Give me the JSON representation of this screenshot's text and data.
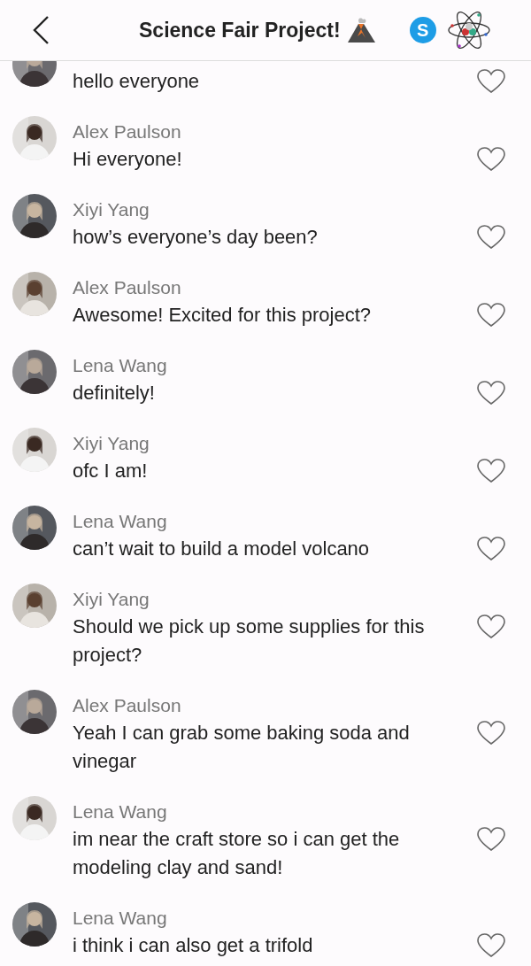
{
  "header": {
    "title": "Science Fair Project!",
    "group_badge": "S"
  },
  "messages": [
    {
      "text": "hello everyone",
      "liked": false
    },
    {
      "name": "Alex Paulson",
      "text": "Hi everyone!",
      "liked": false
    },
    {
      "name": "Xiyi Yang",
      "text": "how’s everyone’s day been?",
      "liked": false
    },
    {
      "name": "Alex Paulson",
      "text": "Awesome! Excited for this project?",
      "liked": false
    },
    {
      "name": "Lena Wang",
      "text": "definitely!",
      "liked": false
    },
    {
      "name": "Xiyi Yang",
      "text": "ofc I am!",
      "liked": false
    },
    {
      "name": "Lena Wang",
      "text": "can’t wait to build a model volcano",
      "liked": false
    },
    {
      "name": "Xiyi Yang",
      "text": "Should we pick up some supplies for this project?",
      "liked": false
    },
    {
      "name": "Alex Paulson",
      "text": "Yeah I can grab some baking soda and vinegar",
      "liked": false
    },
    {
      "name": "Lena Wang",
      "text": "im near the craft store so i can get the modeling clay and sand!",
      "liked": false
    },
    {
      "name": "Lena Wang",
      "text": "i think i can also get a trifold",
      "liked": false
    }
  ]
}
